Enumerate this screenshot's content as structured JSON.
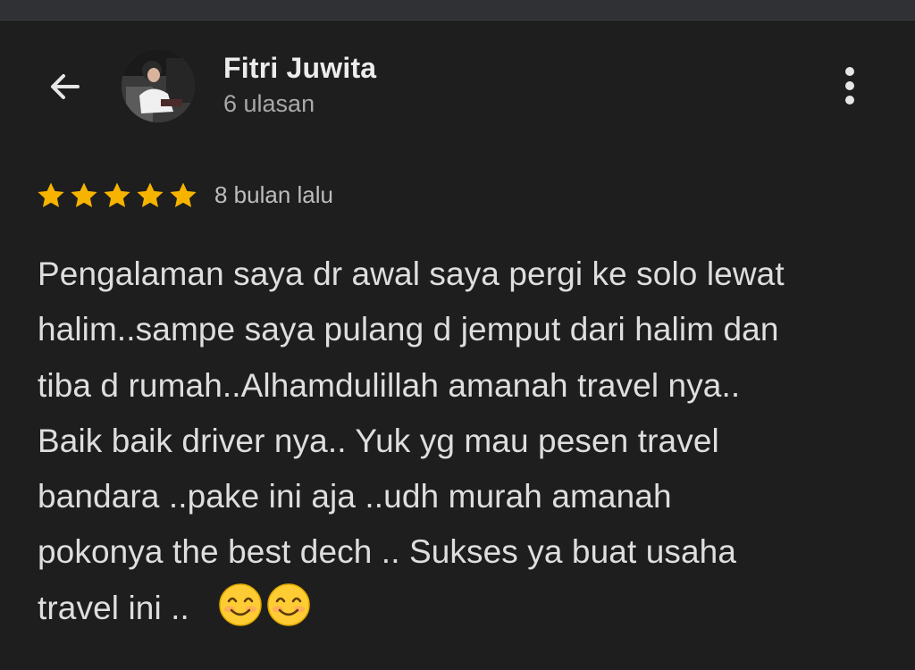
{
  "header": {
    "back_icon": "arrow-left-icon",
    "reviewer_name": "Fitri Juwita",
    "review_count": "6 ulasan",
    "menu_icon": "more-vertical-icon"
  },
  "review": {
    "rating": 5,
    "rating_max": 5,
    "star_color": "#f6b400",
    "date": "8 bulan lalu",
    "text": "Pengalaman saya dr awal saya pergi ke solo lewat\nhalim..sampe saya pulang d jemput dari halim dan\ntiba d rumah..Alhamdulillah amanah travel nya..\nBaik baik driver nya.. Yuk yg mau pesen travel\nbandara ..pake ini aja ..udh murah amanah\npokonya the best dech .. Sukses ya buat usaha\ntravel ini .. ",
    "emojis": [
      "smiling-face-emoji",
      "smiling-face-emoji"
    ]
  },
  "colors": {
    "background": "#1e1e1e",
    "text": "#dedede",
    "muted": "#a9a9a9"
  }
}
